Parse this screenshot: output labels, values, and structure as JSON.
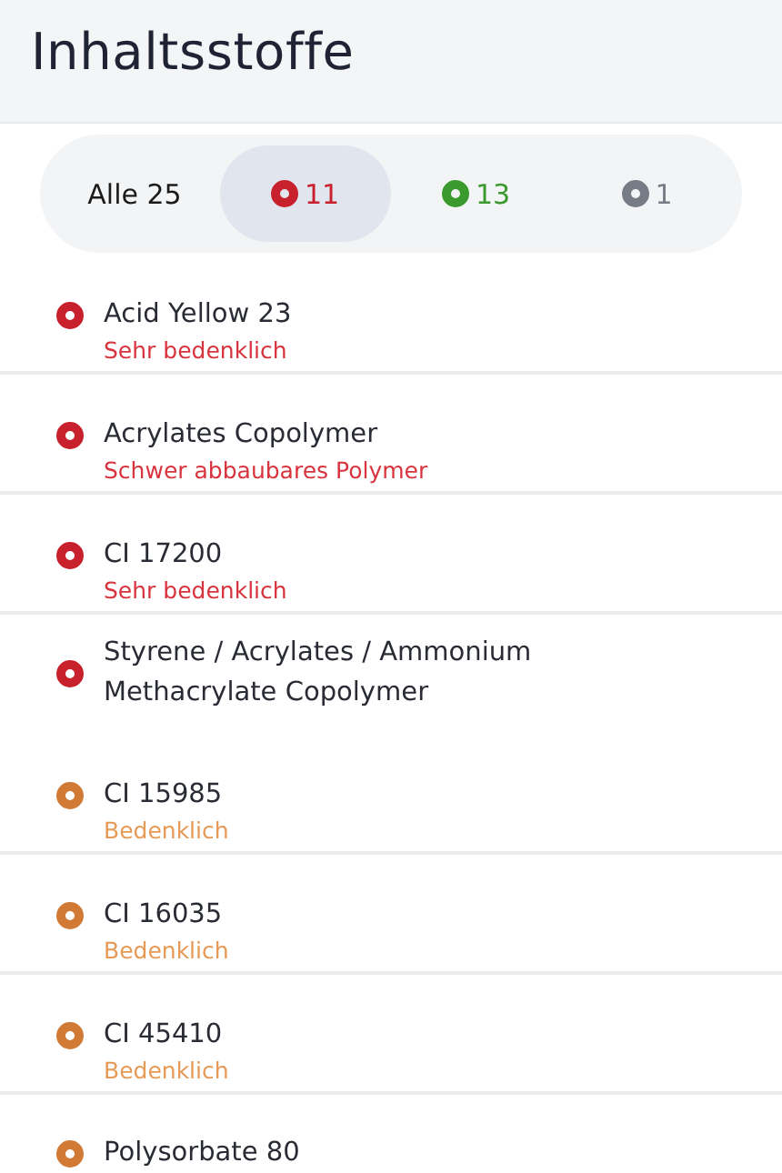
{
  "title": "Inhaltsstoffe",
  "filters": [
    {
      "kind": "all",
      "label": "Alle 25",
      "selected": false
    },
    {
      "kind": "status",
      "count": "11",
      "color": "#c8202c",
      "selected": true
    },
    {
      "kind": "status",
      "count": "13",
      "color": "#3a9a2e",
      "selected": false
    },
    {
      "kind": "status",
      "count": "1",
      "color": "#767c86",
      "selected": false
    }
  ],
  "ingredients": [
    {
      "name": "Acid Yellow 23",
      "note": "Sehr bedenklich",
      "color": "#c8202c",
      "divider": true
    },
    {
      "name": "Acrylates Copolymer",
      "note": "Schwer abbaubares Polymer",
      "color": "#c8202c",
      "divider": true
    },
    {
      "name": "CI 17200",
      "note": "Sehr bedenklich",
      "color": "#c8202c",
      "divider": true
    },
    {
      "name": "Styrene / Acrylates / Ammonium Methacrylate Copolymer",
      "color": "#c8202c",
      "divider": false
    },
    {
      "name": "CI 15985",
      "note": "Bedenklich",
      "color": "#d07a35",
      "divider": true
    },
    {
      "name": "CI 16035",
      "note": "Bedenklich",
      "color": "#d07a35",
      "divider": true
    },
    {
      "name": "CI 45410",
      "note": "Bedenklich",
      "color": "#d07a35",
      "divider": true
    },
    {
      "name": "Polysorbate 80",
      "color": "#d07a35"
    }
  ]
}
